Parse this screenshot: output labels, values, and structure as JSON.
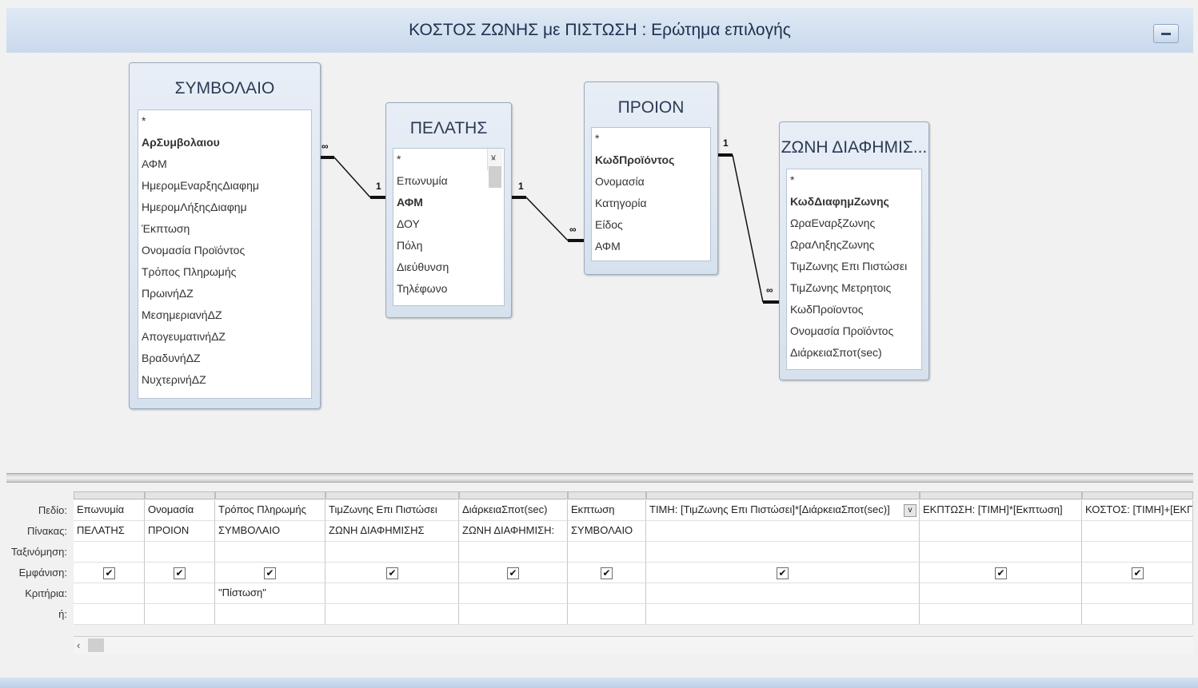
{
  "window": {
    "title": "ΚΟΣΤΟΣ ΖΩΝΗΣ με ΠΙΣΤΩΣΗ : Ερώτημα επιλογής"
  },
  "tables": [
    {
      "name": "ΣΥΜΒΟΛΑΙΟ",
      "fields": [
        {
          "label": "*",
          "pk": false
        },
        {
          "label": "ΑρΣυμβολαιου",
          "pk": true
        },
        {
          "label": "ΑΦΜ",
          "pk": false
        },
        {
          "label": "ΗμεροµΕναρξηςΔιαφημ",
          "pk": false
        },
        {
          "label": "ΗμερομΛήξηςΔιαφημ",
          "pk": false
        },
        {
          "label": "Έκπτωση",
          "pk": false
        },
        {
          "label": "Ονομασία Προϊόντος",
          "pk": false
        },
        {
          "label": "Τρόπος Πληρωμής",
          "pk": false
        },
        {
          "label": "ΠρωινήΔΖ",
          "pk": false
        },
        {
          "label": "ΜεσημεριανήΔΖ",
          "pk": false
        },
        {
          "label": "ΑπογευματινήΔΖ",
          "pk": false
        },
        {
          "label": "ΒραδυνήΔΖ",
          "pk": false
        },
        {
          "label": "ΝυχτερινήΔΖ",
          "pk": false
        }
      ]
    },
    {
      "name": "ΠΕΛΑΤΗΣ",
      "fields": [
        {
          "label": "*",
          "pk": false
        },
        {
          "label": "Επωνυμία",
          "pk": false
        },
        {
          "label": "ΑΦΜ",
          "pk": true
        },
        {
          "label": "ΔΟΥ",
          "pk": false
        },
        {
          "label": "Πόλη",
          "pk": false
        },
        {
          "label": "Διεύθυνση",
          "pk": false
        },
        {
          "label": "Τηλέφωνο",
          "pk": false
        }
      ]
    },
    {
      "name": "ΠΡΟΙΟΝ",
      "fields": [
        {
          "label": "*",
          "pk": false
        },
        {
          "label": "ΚωδΠροϊόντος",
          "pk": true
        },
        {
          "label": "Ονομασία",
          "pk": false
        },
        {
          "label": "Κατηγορία",
          "pk": false
        },
        {
          "label": "Είδος",
          "pk": false
        },
        {
          "label": "ΑΦΜ",
          "pk": false
        }
      ]
    },
    {
      "name": "ΖΩΝΗ ΔΙΑΦΗΜΙΣ...",
      "fields": [
        {
          "label": "*",
          "pk": false
        },
        {
          "label": "ΚωδΔιαφημΖωνης",
          "pk": true
        },
        {
          "label": "ΩραΕναρξΖωνης",
          "pk": false
        },
        {
          "label": "ΩραΛηξηςΖωνης",
          "pk": false
        },
        {
          "label": "ΤιμΖωνης Επι Πιστώσει",
          "pk": false
        },
        {
          "label": "ΤιμΖωνης Μετρητοις",
          "pk": false
        },
        {
          "label": "ΚωδΠροϊοντος",
          "pk": false
        },
        {
          "label": "Ονομασία Προϊόντος",
          "pk": false
        },
        {
          "label": "ΔιάρκειαΣποτ(sec)",
          "pk": false
        }
      ]
    }
  ],
  "relationships": [
    {
      "one": "1",
      "many": "∞"
    },
    {
      "one": "1",
      "many": "∞"
    },
    {
      "one": "1",
      "many": "∞"
    }
  ],
  "grid": {
    "row_labels": [
      "Πεδίο:",
      "Πίνακας:",
      "Ταξινόμηση:",
      "Εμφάνιση:",
      "Κριτήρια:",
      "ή:"
    ],
    "columns": [
      {
        "field": "Επωνυμία",
        "table": "ΠΕΛΑΤΗΣ",
        "show": true,
        "criteria": ""
      },
      {
        "field": "Ονομασία",
        "table": "ΠΡΟΙΟΝ",
        "show": true,
        "criteria": ""
      },
      {
        "field": "Τρόπος Πληρωμής",
        "table": "ΣΥΜΒΟΛΑΙΟ",
        "show": true,
        "criteria": "\"Πίστωση\""
      },
      {
        "field": "ΤιμΖωνης Επι Πιστώσει",
        "table": "ΖΩΝΗ ΔΙΑΦΗΜΙΣΗΣ",
        "show": true,
        "criteria": ""
      },
      {
        "field": "ΔιάρκειαΣποτ(sec)",
        "table": "ΖΩΝΗ ΔΙΑΦΗΜΙΣΗ:",
        "show": true,
        "criteria": ""
      },
      {
        "field": "Εκπτωση",
        "table": "ΣΥΜΒΟΛΑΙΟ",
        "show": true,
        "criteria": ""
      },
      {
        "field": "ΤΙΜΗ: [ΤιμΖωνης Επι Πιστώσει]*[ΔιάρκειαΣποτ(sec)]",
        "table": "",
        "show": true,
        "criteria": ""
      },
      {
        "field": "ΕΚΠΤΩΣΗ: [ΤΙΜΗ]*[Εκπτωση]",
        "table": "",
        "show": true,
        "criteria": ""
      },
      {
        "field": "ΚΟΣΤΟΣ: [ΤΙΜΗ]+[ΕΚΠ",
        "table": "",
        "show": true,
        "criteria": ""
      }
    ]
  },
  "icons": {
    "check": "✔",
    "scroll_left": "‹",
    "scroll_up": "^",
    "scroll_down": "v",
    "dropdown": "v"
  }
}
